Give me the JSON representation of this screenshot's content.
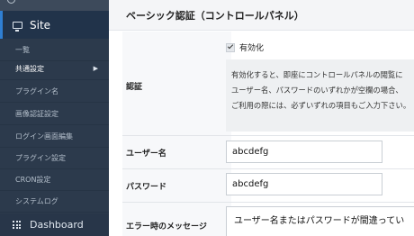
{
  "sidebar": {
    "site_label": "Site",
    "items": [
      {
        "label": "一覧"
      },
      {
        "label": "共通設定"
      },
      {
        "label": "プラグイン名"
      },
      {
        "label": "画像認証設定"
      },
      {
        "label": "ログイン画面編集"
      },
      {
        "label": "プラグイン設定"
      },
      {
        "label": "CRON設定"
      },
      {
        "label": "システムログ"
      }
    ],
    "dashboard_label": "Dashboard"
  },
  "main": {
    "title": "ベーシック認証（コントロールパネル）",
    "auth_label": "認証",
    "enable_label": "有効化",
    "enabled": true,
    "help_lines": [
      "有効化すると、即座にコントロールパネルの閲覧に",
      "ユーザー名、パスワードのいずれかが空欄の場合、",
      "ご利用の際には、必ずいずれの項目もご入力下さい。"
    ],
    "username_label": "ユーザー名",
    "username_value": "abcdefg",
    "password_label": "パスワード",
    "password_value": "abcdefg",
    "error_label": "エラー時のメッセージ",
    "error_value": "ユーザー名またはパスワードが間違ってい"
  }
}
